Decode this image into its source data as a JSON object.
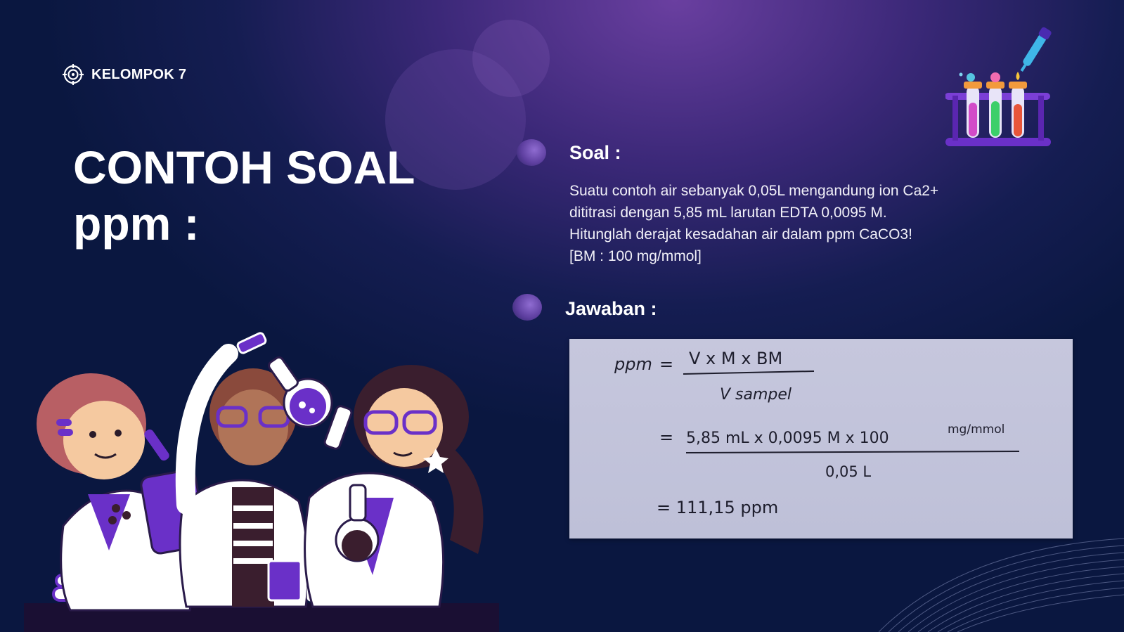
{
  "brand": {
    "label": "KELOMPOK 7",
    "icon": "target-icon"
  },
  "title": {
    "line1": "CONTOH SOAL",
    "line2": "ppm :"
  },
  "question": {
    "heading": "Soal :",
    "lines": [
      "Suatu contoh air sebanyak 0,05L mengandung ion Ca2+",
      "dititrasi dengan 5,85 mL larutan EDTA 0,0095 M.",
      "Hitunglah derajat kesadahan air dalam ppm CaCO3!",
      "[BM : 100 mg/mmol]"
    ]
  },
  "answer": {
    "heading": "Jawaban :",
    "handwritten": {
      "lhs": "ppm",
      "eq": "=",
      "formula_numerator": "V x M x BM",
      "formula_denominator": "V sampel",
      "step_numerator": "5,85 mL x 0,0095 M x 100",
      "step_unit": "mg/mmol",
      "step_denominator": "0,05 L",
      "result": "= 111,15 ppm"
    }
  },
  "colors": {
    "accent": "#6a3fd0",
    "background": "#0a1740",
    "card": "#c3c5dc"
  }
}
